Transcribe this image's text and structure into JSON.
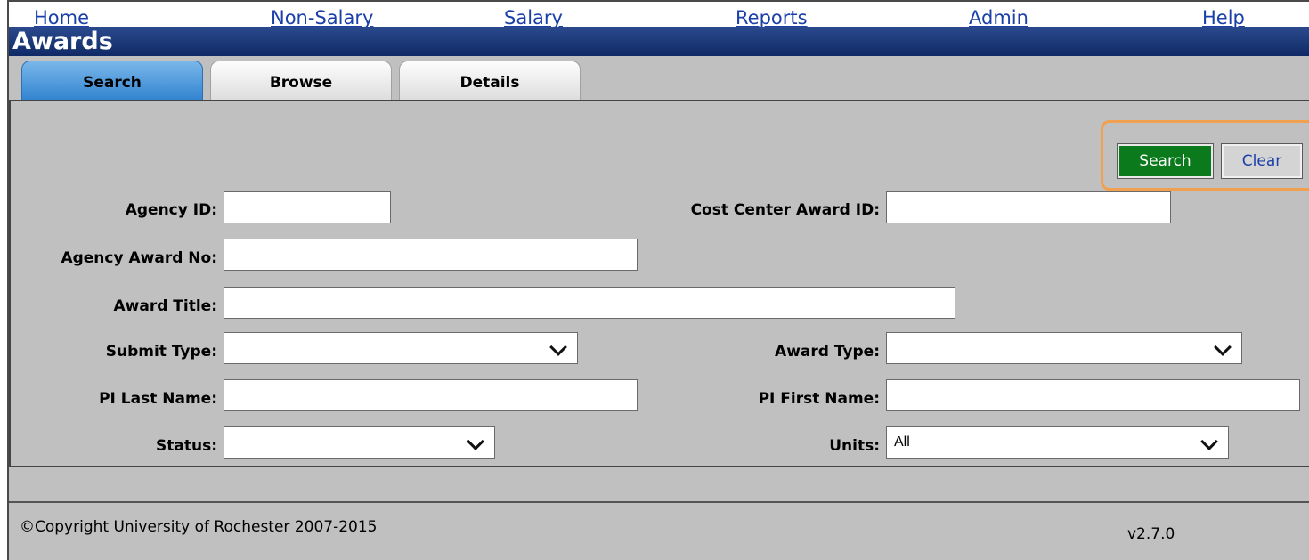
{
  "nav": {
    "home": "Home",
    "non_salary": "Non-Salary",
    "salary": "Salary",
    "reports": "Reports",
    "admin": "Admin",
    "help": "Help"
  },
  "page": {
    "title": "Awards"
  },
  "tabs": {
    "search": "Search",
    "browse": "Browse",
    "details": "Details",
    "active": "Search"
  },
  "actions": {
    "search": "Search",
    "clear": "Clear"
  },
  "form": {
    "agency_id": {
      "label": "Agency ID:",
      "value": ""
    },
    "cost_center_award_id": {
      "label": "Cost Center Award ID:",
      "value": ""
    },
    "agency_award_no": {
      "label": "Agency Award No:",
      "value": ""
    },
    "award_title": {
      "label": "Award Title:",
      "value": ""
    },
    "submit_type": {
      "label": "Submit Type:",
      "value": ""
    },
    "award_type": {
      "label": "Award Type:",
      "value": ""
    },
    "pi_last_name": {
      "label": "PI Last Name:",
      "value": ""
    },
    "pi_first_name": {
      "label": "PI First Name:",
      "value": ""
    },
    "status": {
      "label": "Status:",
      "value": ""
    },
    "units": {
      "label": "Units:",
      "value": "All"
    }
  },
  "footer": {
    "copyright": "©Copyright University of Rochester 2007-2015",
    "version": "v2.7.0"
  },
  "colors": {
    "title_bar": "#1a3775",
    "link": "#1a3fa8",
    "search_button": "#0b7a1c",
    "active_tab": "#4a9ae0",
    "highlight_outline": "#f0a050",
    "background": "#c0c0c0"
  },
  "icons": {
    "dropdown": "chevron-down-icon"
  }
}
